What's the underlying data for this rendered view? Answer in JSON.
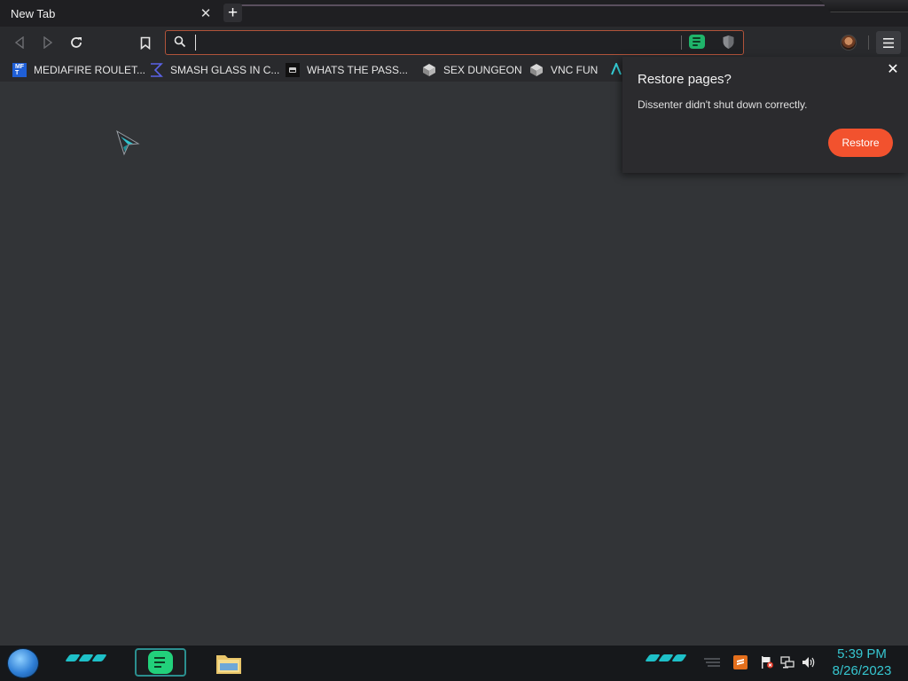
{
  "tab": {
    "title": "New Tab",
    "close_glyph": "✕",
    "new_tab_glyph": "+"
  },
  "toolbar": {
    "back_icon": "back-arrow-icon",
    "forward_icon": "forward-arrow-icon",
    "reload_icon": "reload-icon",
    "bookmark_icon": "bookmark-icon",
    "search_placeholder": "",
    "search_value": ""
  },
  "bookmarks": [
    {
      "label": "MEDIAFIRE ROULET...",
      "icon": "mediafire-icon"
    },
    {
      "label": "SMASH GLASS IN C...",
      "icon": "sigma-icon"
    },
    {
      "label": "WHATS THE PASS...",
      "icon": "terminal-icon"
    },
    {
      "label": "SEX DUNGEON",
      "icon": "cube-icon"
    },
    {
      "label": "VNC FUN",
      "icon": "cube-icon"
    }
  ],
  "restore_dialog": {
    "title": "Restore pages?",
    "message": "Dissenter didn't shut down correctly.",
    "button": "Restore",
    "close_glyph": "✕"
  },
  "taskbar": {
    "time": "5:39 PM",
    "date": "8/26/2023"
  },
  "colors": {
    "accent_orange": "#f2522e",
    "gab_green": "#22d17b",
    "clock_cyan": "#36c6d0"
  }
}
